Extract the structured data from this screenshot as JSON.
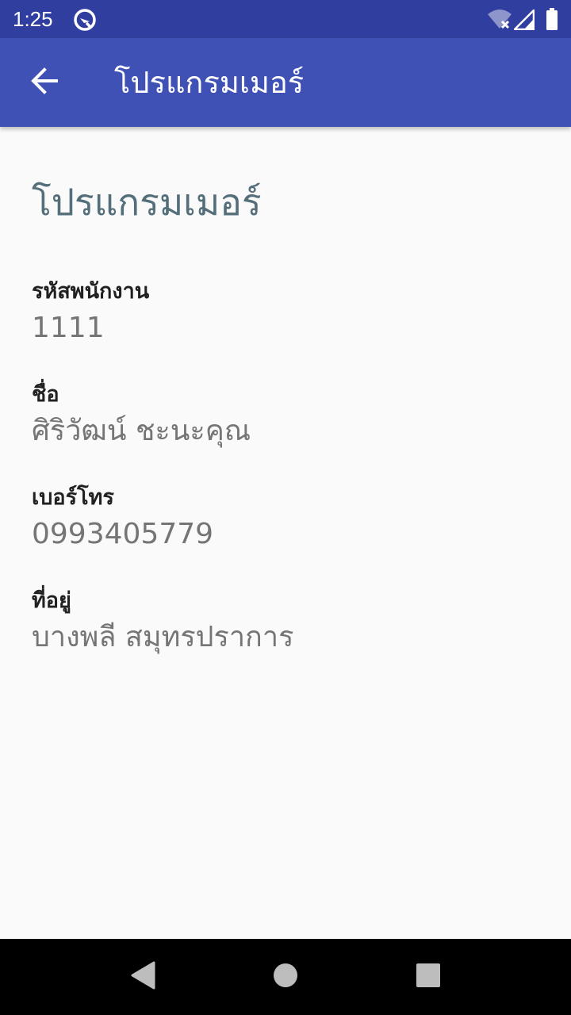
{
  "status_bar": {
    "time": "1:25"
  },
  "app_bar": {
    "title": "โปรแกรมเมอร์"
  },
  "profile": {
    "position": "โปรแกรมเมอร์",
    "fields": [
      {
        "label": "รหัสพนักงาน",
        "value": "1111"
      },
      {
        "label": "ชื่อ",
        "value": "ศิริวัฒน์ ชะนะคุณ"
      },
      {
        "label": "เบอร์โทร",
        "value": "0993405779"
      },
      {
        "label": "ที่อยู่",
        "value": "บางพลี สมุทรปราการ"
      }
    ]
  },
  "colors": {
    "status_bar": "#303f9f",
    "app_bar": "#3f51b5",
    "background": "#fafafa",
    "title_text": "#546e7a",
    "label_text": "#212121",
    "value_text": "#757575"
  },
  "icons": {
    "status_app": "app-notification-icon",
    "wifi": "wifi-icon",
    "signal": "signal-icon",
    "battery": "battery-icon",
    "back": "arrow-back-icon",
    "nav_back": "nav-back-icon",
    "nav_home": "nav-home-icon",
    "nav_recents": "nav-recents-icon"
  }
}
